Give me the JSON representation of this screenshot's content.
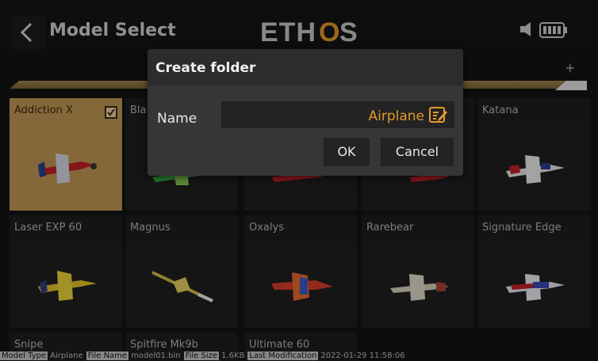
{
  "header": {
    "title": "Model Select",
    "logo_text": "ETHOS"
  },
  "tabs": {
    "add_label": "+"
  },
  "models": [
    {
      "name": "Addiction X",
      "selected": true
    },
    {
      "name": "Bla",
      "selected": false
    },
    {
      "name": "",
      "selected": false
    },
    {
      "name": "",
      "selected": false
    },
    {
      "name": "Katana",
      "selected": false
    },
    {
      "name": "Laser EXP 60",
      "selected": false
    },
    {
      "name": "Magnus",
      "selected": false
    },
    {
      "name": "Oxalys",
      "selected": false
    },
    {
      "name": "Rarebear",
      "selected": false
    },
    {
      "name": "Signature Edge",
      "selected": false
    },
    {
      "name": "Snipe",
      "selected": false
    },
    {
      "name": "Spitfire Mk9b",
      "selected": false
    },
    {
      "name": "Ultimate 60",
      "selected": false
    }
  ],
  "status_bar": {
    "model_type_label": "Model Type",
    "model_type_value": "Airplane",
    "file_name_label": "File Name",
    "file_name_value": "model01.bin",
    "file_size_label": "File Size",
    "file_size_value": "1.6KB",
    "last_mod_label": "Last Modification",
    "last_mod_value": "2022-01-29 11:58:06"
  },
  "dialog": {
    "title": "Create folder",
    "name_label": "Name",
    "name_value": "Airplane",
    "ok_label": "OK",
    "cancel_label": "Cancel"
  },
  "colors": {
    "accent": "#e39a2c",
    "selected_tile": "#c49a54"
  }
}
